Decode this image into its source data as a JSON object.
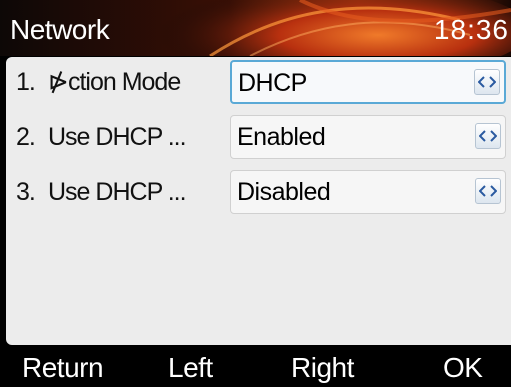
{
  "header": {
    "title": "Network",
    "clock": "18:36"
  },
  "rows": [
    {
      "number": "1.",
      "label": "⋫ction Mode",
      "value": "DHCP",
      "switch_icon": "left-right-arrows-icon"
    },
    {
      "number": "2.",
      "label": "Use DHCP ...",
      "value": "Enabled",
      "switch_icon": "left-right-arrows-icon"
    },
    {
      "number": "3.",
      "label": "Use DHCP ...",
      "value": "Disabled",
      "switch_icon": "left-right-arrows-icon"
    }
  ],
  "softkeys": {
    "return": "Return",
    "left": "Left",
    "right": "Right",
    "ok": "OK"
  },
  "colors": {
    "header_background": "#0d0806",
    "swirl_accent": "#e0501a",
    "panel_background": "#ececec",
    "focus_border": "#5aa9d6",
    "softkey_text": "#ffffff"
  }
}
